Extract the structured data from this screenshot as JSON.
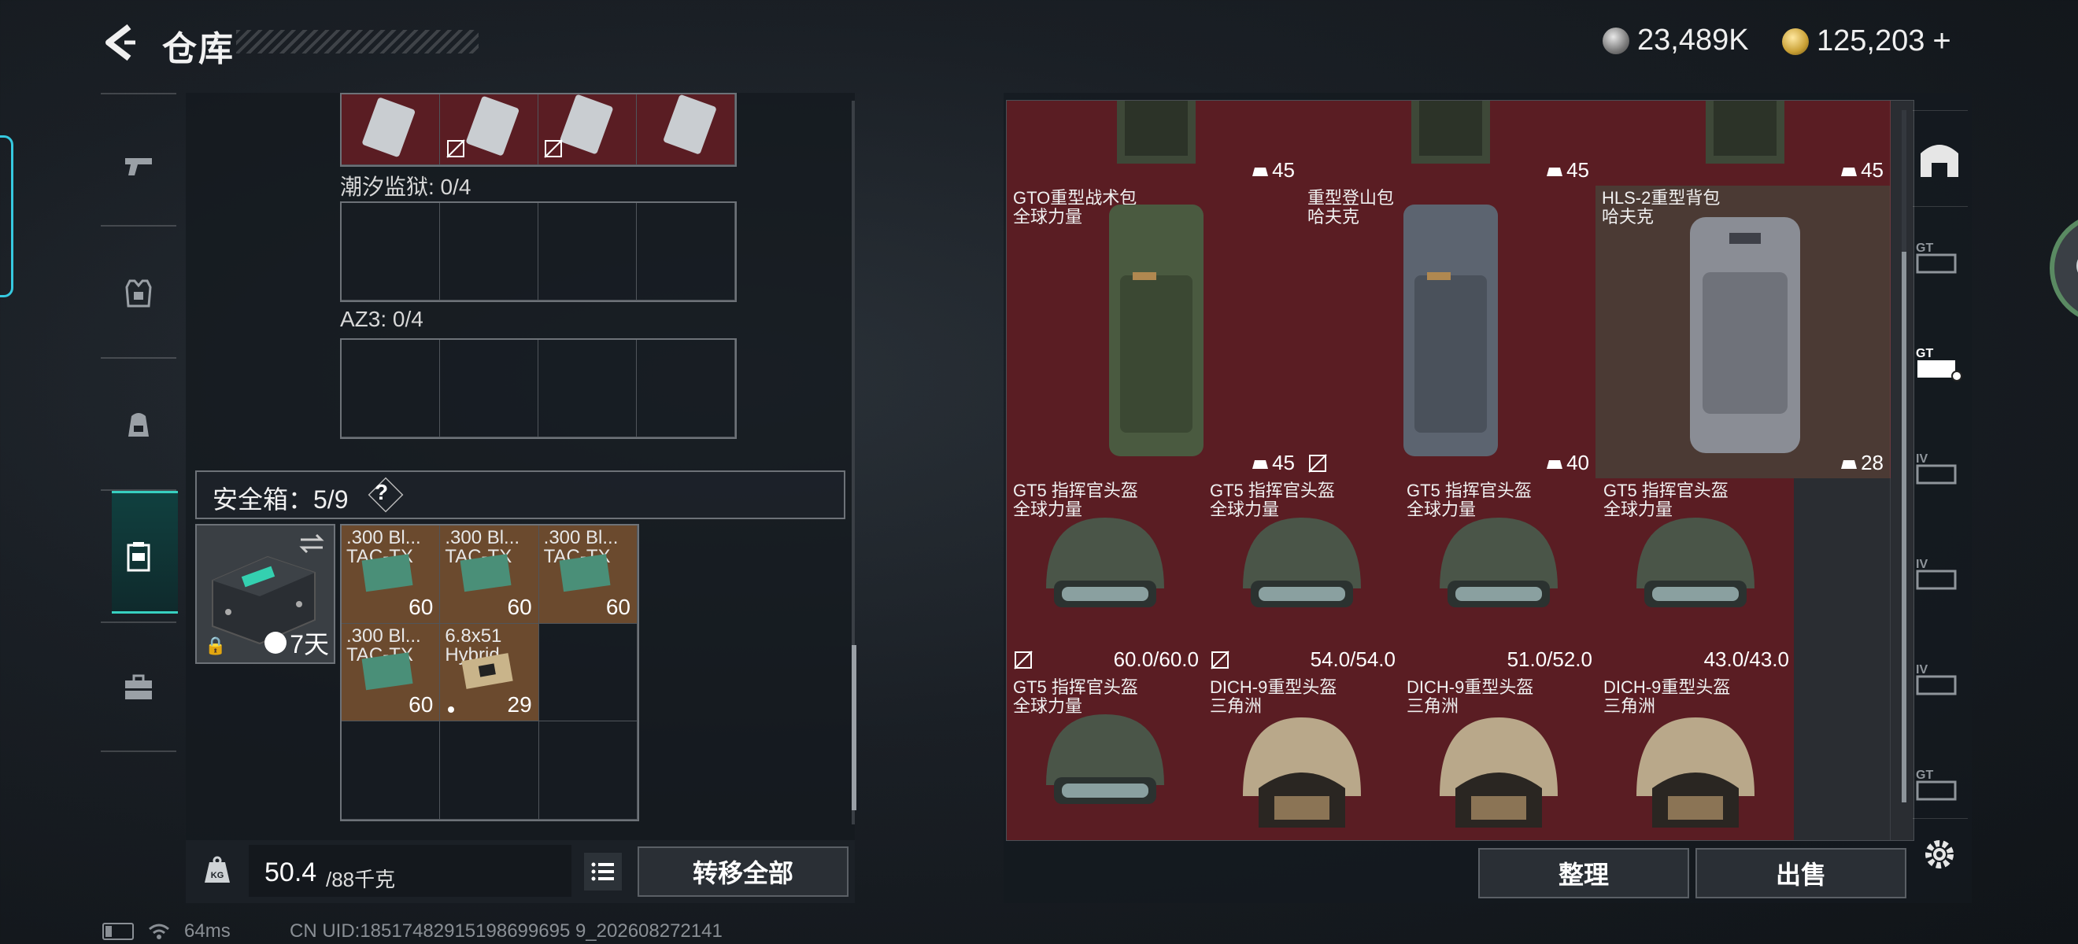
{
  "header": {
    "title": "仓库",
    "currency_1": "23,489K",
    "currency_2": "125,203",
    "plus": "+"
  },
  "left_nav": {
    "items": [
      "weapon",
      "armor",
      "backpack",
      "safebox",
      "case"
    ],
    "active": "safebox"
  },
  "left_panel": {
    "sections": [
      {
        "label": "潮汐监狱: 0/4"
      },
      {
        "label": "AZ3: 0/4"
      }
    ],
    "safe_box": {
      "label": "安全箱：5/9",
      "help": "?",
      "days": "7天"
    },
    "ammo": [
      {
        "name": ".300 Bl...",
        "sub": "TAC-TX",
        "qty": "60"
      },
      {
        "name": ".300 Bl...",
        "sub": "TAC-TX",
        "qty": "60"
      },
      {
        "name": ".300 Bl...",
        "sub": "TAC-TX",
        "qty": "60"
      },
      {
        "name": ".300 Bl...",
        "sub": "TAC-TX",
        "qty": "60"
      },
      {
        "name": "6.8x51",
        "sub": "Hybrid",
        "qty": "29"
      }
    ],
    "weight_value": "50.4",
    "weight_unit": "/88千克",
    "transfer_label": "转移全部"
  },
  "stash": {
    "top_counts": [
      "45",
      "45",
      "45"
    ],
    "backpacks": [
      {
        "name": "GTO重型战术包",
        "brand": "全球力量",
        "count": "45"
      },
      {
        "name": "重型登山包",
        "brand": "哈夫克",
        "count": "40"
      },
      {
        "name": "HLS-2重型背包",
        "brand": "哈夫克",
        "count": "28"
      }
    ],
    "helmets_row1": [
      {
        "name": "GT5 指挥官头盔",
        "brand": "全球力量",
        "durability": "60.0/60.0"
      },
      {
        "name": "GT5 指挥官头盔",
        "brand": "全球力量",
        "durability": "54.0/54.0"
      },
      {
        "name": "GT5 指挥官头盔",
        "brand": "全球力量",
        "durability": "51.0/52.0"
      },
      {
        "name": "GT5 指挥官头盔",
        "brand": "全球力量",
        "durability": "43.0/43.0"
      }
    ],
    "helmets_row2": [
      {
        "name": "GT5 指挥官头盔",
        "brand": "全球力量"
      },
      {
        "name": "DICH-9重型头盔",
        "brand": "三角洲"
      },
      {
        "name": "DICH-9重型头盔",
        "brand": "三角洲"
      },
      {
        "name": "DICH-9重型头盔",
        "brand": "三角洲"
      }
    ],
    "sort_label": "整理",
    "sell_label": "出售"
  },
  "status": {
    "ping": "64ms",
    "uid": "CN UID:18517482915198699695 9_202608272141"
  },
  "colors": {
    "accent": "#37d0c0",
    "item_red": "#5a1d23",
    "ammo_brown": "#6b4a2e"
  }
}
